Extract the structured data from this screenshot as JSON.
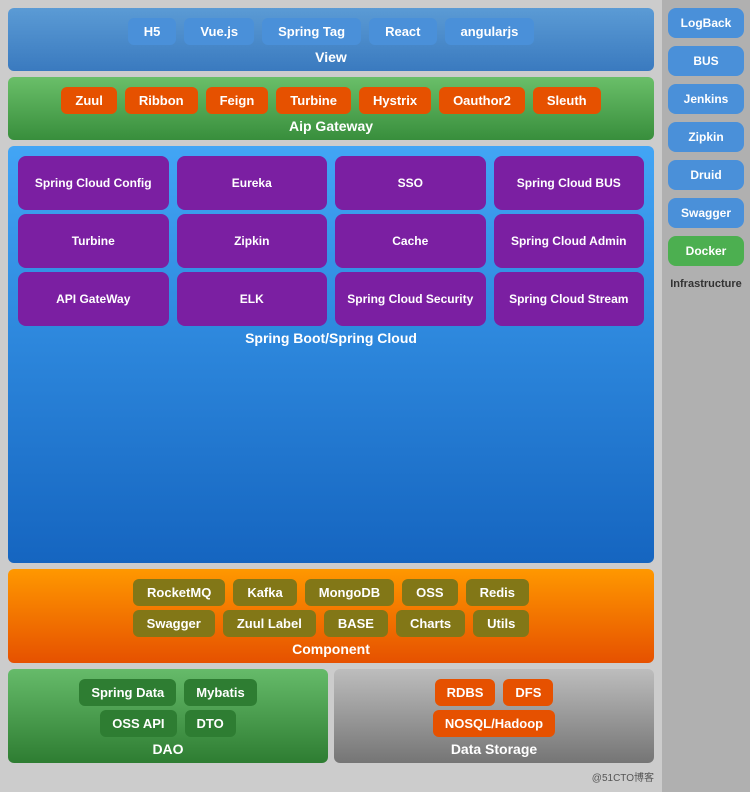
{
  "view": {
    "label": "View",
    "tags": [
      "H5",
      "Vue.js",
      "Spring Tag",
      "React",
      "angularjs"
    ]
  },
  "gateway": {
    "label": "Aip Gateway",
    "tags": [
      "Zuul",
      "Ribbon",
      "Feign",
      "Turbine",
      "Hystrix",
      "Oauthor2",
      "Sleuth"
    ]
  },
  "springboot": {
    "label": "Spring Boot/Spring Cloud",
    "row1": [
      "Spring Cloud Config",
      "Eureka",
      "SSO",
      "Spring Cloud BUS"
    ],
    "row2": [
      "Turbine",
      "Zipkin",
      "Cache",
      "Spring Cloud Admin"
    ],
    "row3": [
      "API GateWay",
      "ELK",
      "Spring Cloud Security",
      "Spring Cloud Stream"
    ]
  },
  "component": {
    "label": "Component",
    "row1": [
      "RocketMQ",
      "Kafka",
      "MongoDB",
      "OSS",
      "Redis"
    ],
    "row2": [
      "Swagger",
      "Zuul Label",
      "BASE",
      "Charts",
      "Utils"
    ]
  },
  "dao": {
    "label": "DAO",
    "row1": [
      "Spring Data",
      "Mybatis"
    ],
    "row2": [
      "OSS API",
      "DTO"
    ]
  },
  "datastorage": {
    "label": "Data Storage",
    "row1": [
      "RDBS",
      "DFS"
    ],
    "row2": [
      "NOSQL/Hadoop"
    ]
  },
  "sidebar": {
    "items": [
      {
        "label": "LogBack",
        "type": "blue"
      },
      {
        "label": "BUS",
        "type": "blue"
      },
      {
        "label": "Jenkins",
        "type": "blue"
      },
      {
        "label": "Zipkin",
        "type": "blue"
      },
      {
        "label": "Druid",
        "type": "blue"
      },
      {
        "label": "Swagger",
        "type": "blue"
      },
      {
        "label": "Docker",
        "type": "green"
      },
      {
        "label": "Infrastructure",
        "type": "gray"
      }
    ]
  },
  "watermark": "@51CTO博客"
}
